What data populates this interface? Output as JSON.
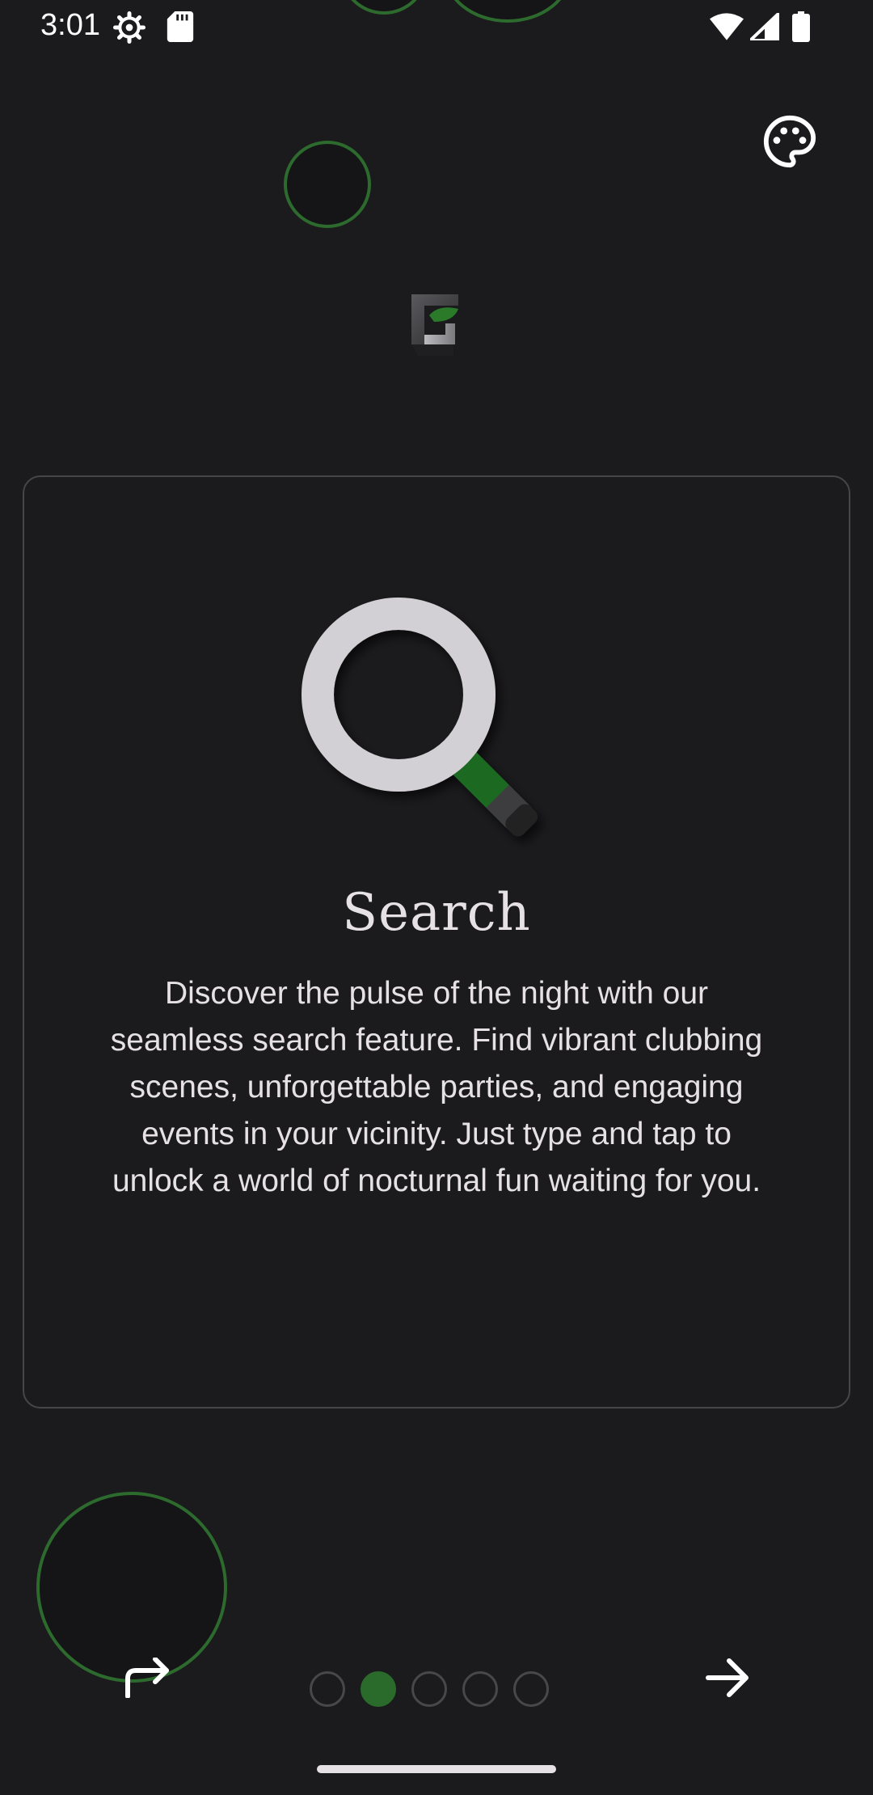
{
  "status_bar": {
    "time": "3:01",
    "icons": [
      "settings-icon",
      "sd-card-icon",
      "wifi-icon",
      "signal-icon",
      "battery-icon"
    ]
  },
  "header": {
    "theme_button_icon": "palette-icon",
    "logo_icon": "app-logo-icon"
  },
  "onboarding": {
    "feature_icon": "search-magnifier-icon",
    "title": "Search",
    "description": "Discover the pulse of the night with our seamless search feature. Find vibrant clubbing scenes, unforgettable parties, and engaging events in your vicinity. Just type and tap to unlock a world of nocturnal fun waiting for you."
  },
  "navigation": {
    "skip_icon": "skip-arrow-icon",
    "next_icon": "arrow-forward-icon",
    "page_count": 5,
    "current_page": 2
  },
  "colors": {
    "background": "#1b1a1d",
    "accent_green": "#2a6b2b",
    "text": "#e6e1e5",
    "card_border": "#47454a"
  }
}
